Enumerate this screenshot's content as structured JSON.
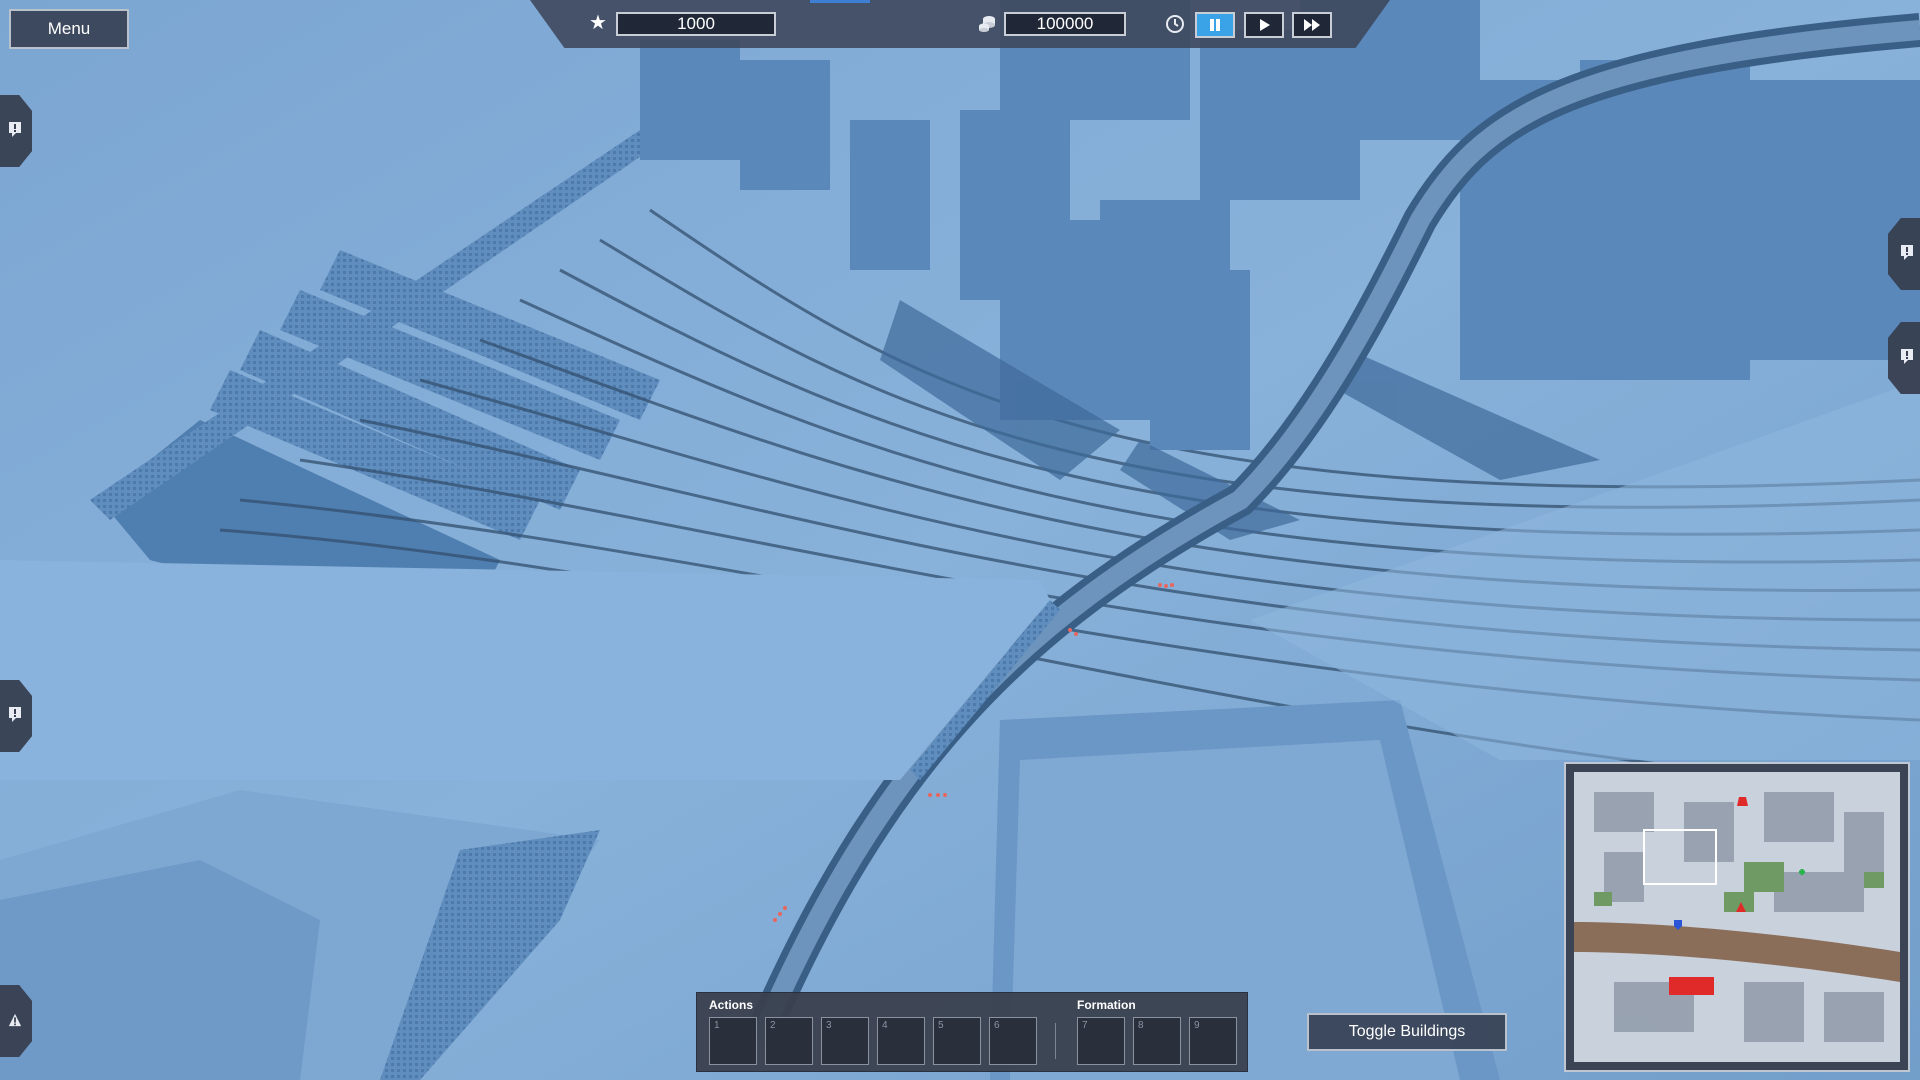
{
  "hud": {
    "menu_label": "Menu",
    "stars_value": "1000",
    "money_value": "100000",
    "icons": {
      "stars": "star-icon",
      "money": "coins-icon",
      "time": "clock-icon",
      "pause": "pause-icon",
      "play": "play-icon",
      "fast_forward": "fast-forward-icon",
      "alert": "exclamation-icon",
      "warning": "warning-icon"
    },
    "active_speed": "pause"
  },
  "actions_panel": {
    "actions_label": "Actions",
    "formation_label": "Formation",
    "action_slots": [
      "1",
      "2",
      "3",
      "4",
      "5",
      "6"
    ],
    "formation_slots": [
      "7",
      "8",
      "9"
    ]
  },
  "toggle_buildings_label": "Toggle Buildings",
  "colors": {
    "accent": "#3aa3e8",
    "panel": "#373f50",
    "alert_red": "#e02a2a",
    "minimap_river": "#8a6e5a"
  }
}
